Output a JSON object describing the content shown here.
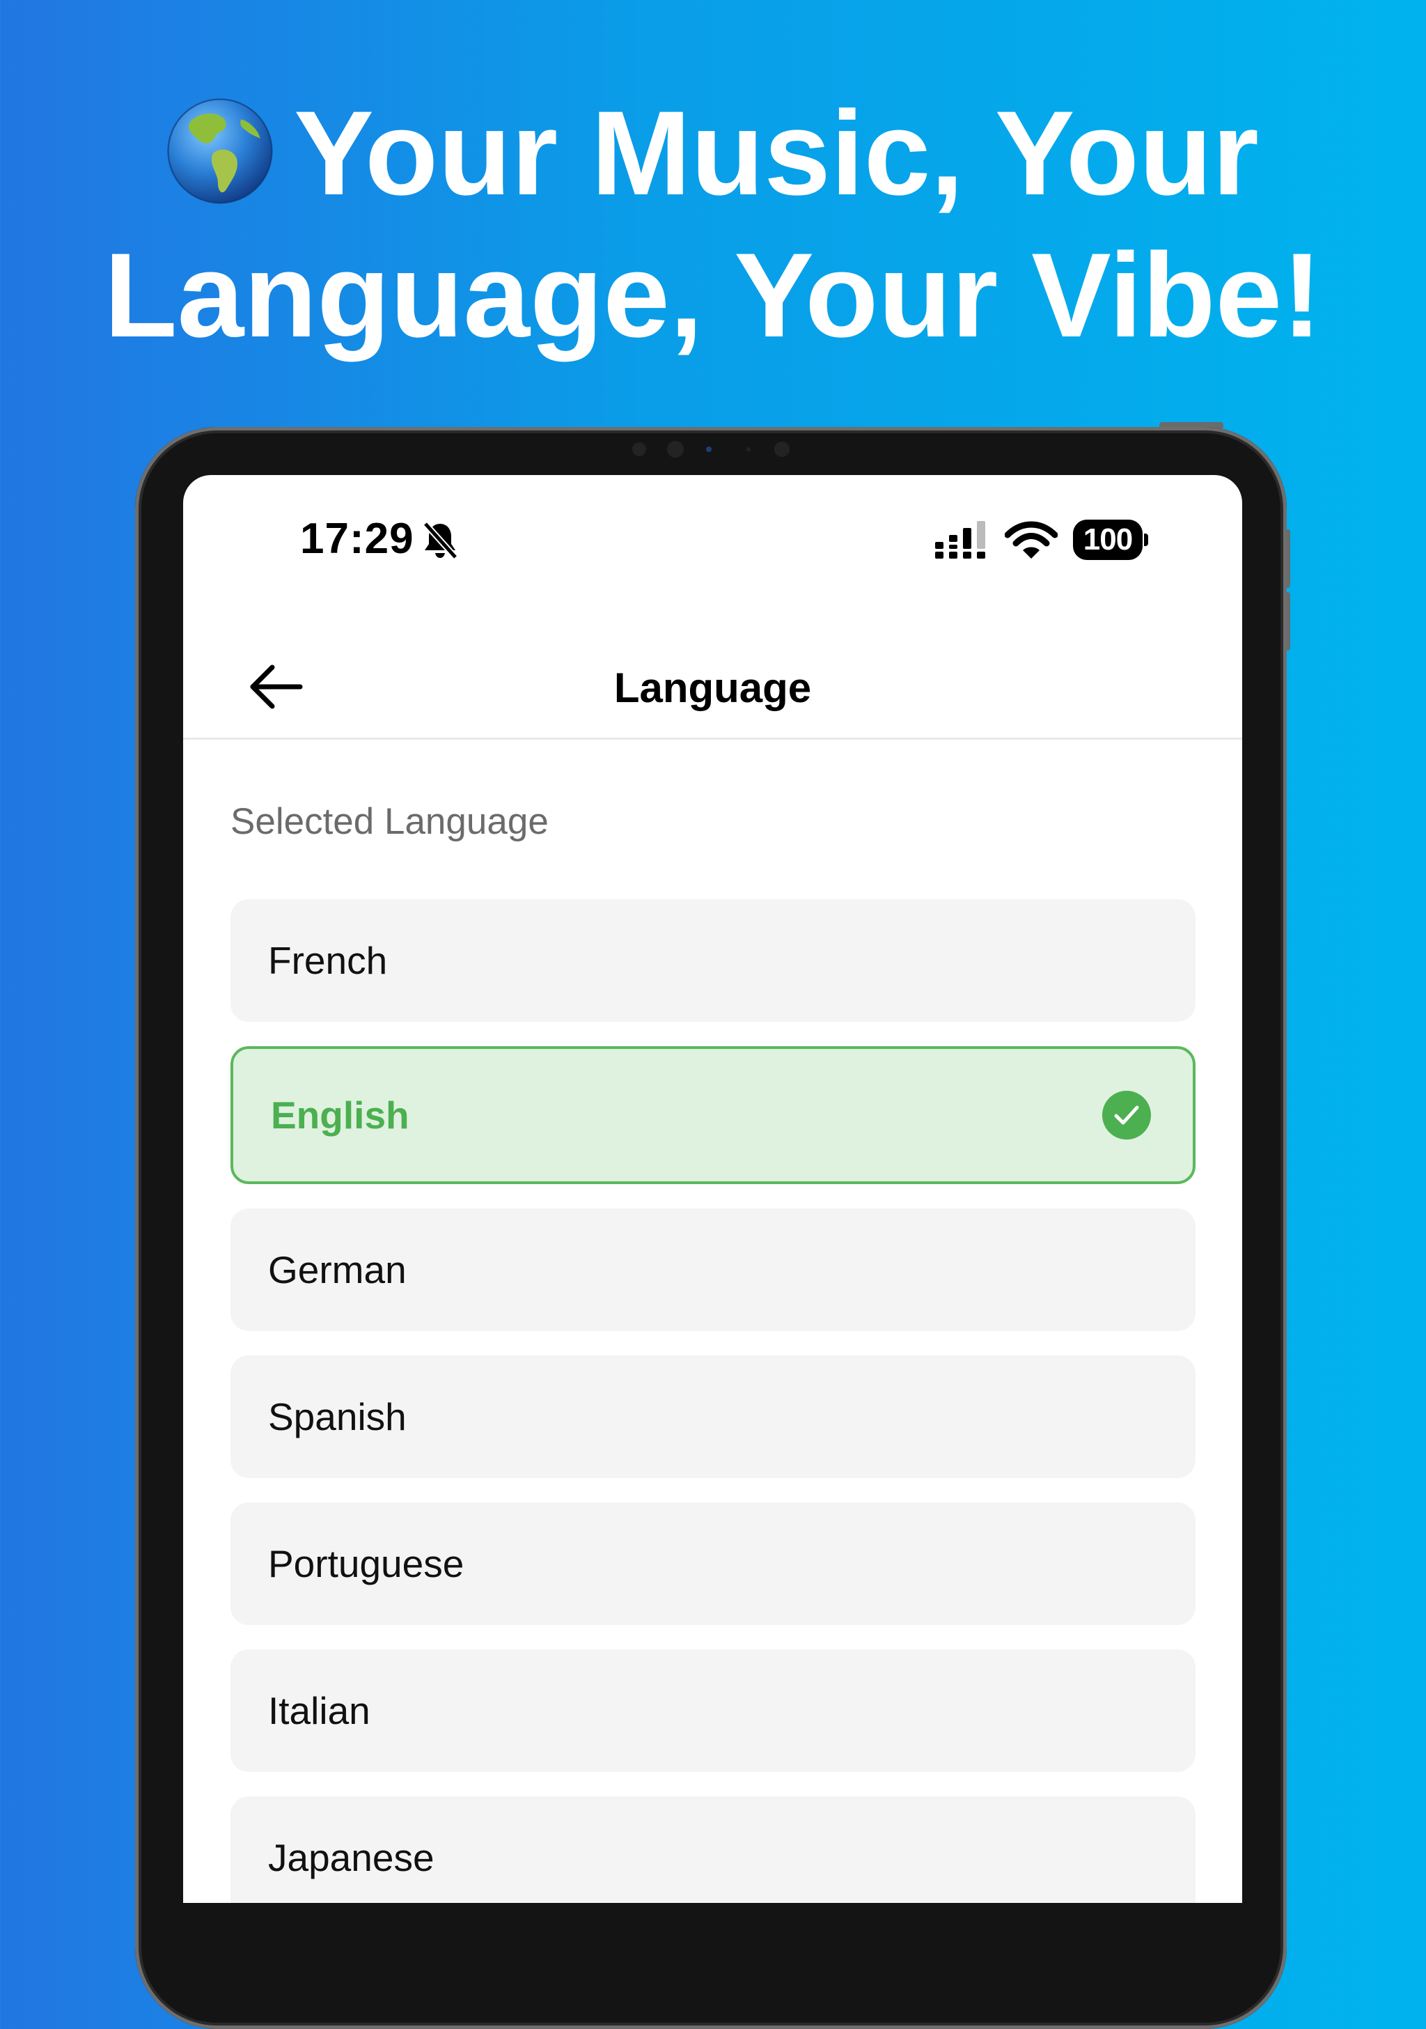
{
  "headline": {
    "line1": "Your Music, Your",
    "line2": "Language, Your Vibe!"
  },
  "status_bar": {
    "time": "17:29",
    "battery": "100"
  },
  "nav": {
    "title": "Language"
  },
  "section_label": "Selected Language",
  "languages": [
    {
      "label": "French",
      "selected": false
    },
    {
      "label": "English",
      "selected": true
    },
    {
      "label": "German",
      "selected": false
    },
    {
      "label": "Spanish",
      "selected": false
    },
    {
      "label": "Portuguese",
      "selected": false
    },
    {
      "label": "Italian",
      "selected": false
    },
    {
      "label": "Japanese",
      "selected": false
    }
  ],
  "colors": {
    "background_start": "#2276e2",
    "background_end": "#00b3ee",
    "selected_green": "#4caf50",
    "selected_bg": "#dff2df",
    "item_bg": "#f4f4f4"
  },
  "icons": {
    "headline": "globe-americas-icon",
    "back": "arrow-left-icon",
    "selected": "check-circle-icon",
    "silent": "bell-slash-icon",
    "cellular": "cellular-signal-icon",
    "wifi": "wifi-icon",
    "battery": "battery-icon"
  }
}
